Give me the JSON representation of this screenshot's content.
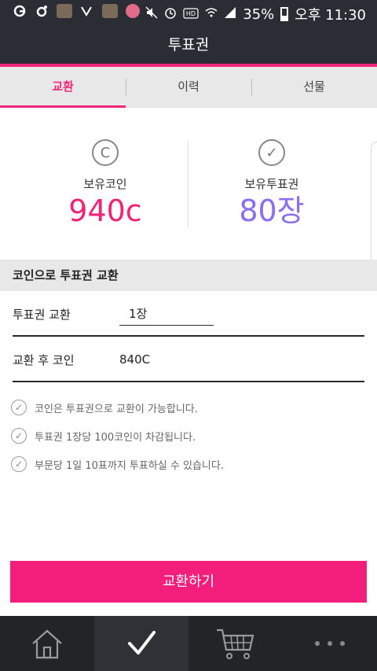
{
  "statusbar": {
    "battery": "35%",
    "time": "오후 11:30"
  },
  "title": "투표권",
  "tabs": [
    {
      "label": "교환"
    },
    {
      "label": "이력"
    },
    {
      "label": "선물"
    }
  ],
  "stats": {
    "coin": {
      "icon": "coin-icon",
      "label": "보유코인",
      "value": "940c"
    },
    "ticket": {
      "icon": "check-circle-icon",
      "label": "보유투표권",
      "value": "80장"
    }
  },
  "section": {
    "title": "코인으로 투표권 교환"
  },
  "exchange": {
    "ticket_label": "투표권 교환",
    "ticket_value": "1장",
    "after_label": "교환 후 코인",
    "after_value": "840C"
  },
  "notes": [
    "코인은 투표권으로 교환이 가능합니다.",
    "투표권 1장당 100코인이 차감됩니다.",
    "부문당 1일 10표까지 투표하실 수 있습니다."
  ],
  "action_button": "교환하기",
  "bottom_nav": [
    {
      "icon": "home-icon",
      "active": false
    },
    {
      "icon": "check-icon",
      "active": true
    },
    {
      "icon": "cart-icon",
      "active": false
    },
    {
      "icon": "more-icon",
      "active": false
    }
  ],
  "colors": {
    "accent": "#f31d7b",
    "ticket": "#8b6cf4",
    "dark": "#2b2d34"
  }
}
